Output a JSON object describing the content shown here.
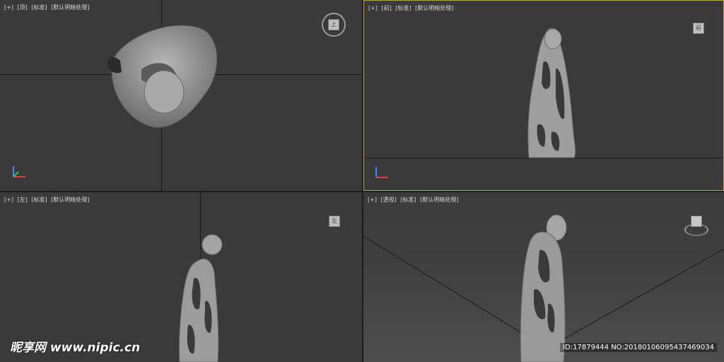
{
  "viewports": {
    "top": {
      "label_plus": "[+]",
      "label_view": "[顶]",
      "label_shading": "[标准]",
      "label_lighting": "[默认明暗处理]",
      "navcube_face": "上"
    },
    "front": {
      "label_plus": "[+]",
      "label_view": "[前]",
      "label_shading": "[标准]",
      "label_lighting": "[默认明暗处理]",
      "navcube_face": "前"
    },
    "left": {
      "label_plus": "[+]",
      "label_view": "[左]",
      "label_shading": "[标准]",
      "label_lighting": "[默认明暗处理]",
      "navcube_face": "左"
    },
    "perspective": {
      "label_plus": "[+]",
      "label_view": "[透视]",
      "label_shading": "[标准]",
      "label_lighting": "[默认明暗处理]"
    }
  },
  "watermark": {
    "logo": "昵享网 www.nipic.cn",
    "id_text": "ID:17879444 NO:20180106095437469034"
  },
  "colors": {
    "active_border": "#bca24a",
    "viewport_bg": "#3a3a3a",
    "model_gray": "#9b9b9b"
  }
}
